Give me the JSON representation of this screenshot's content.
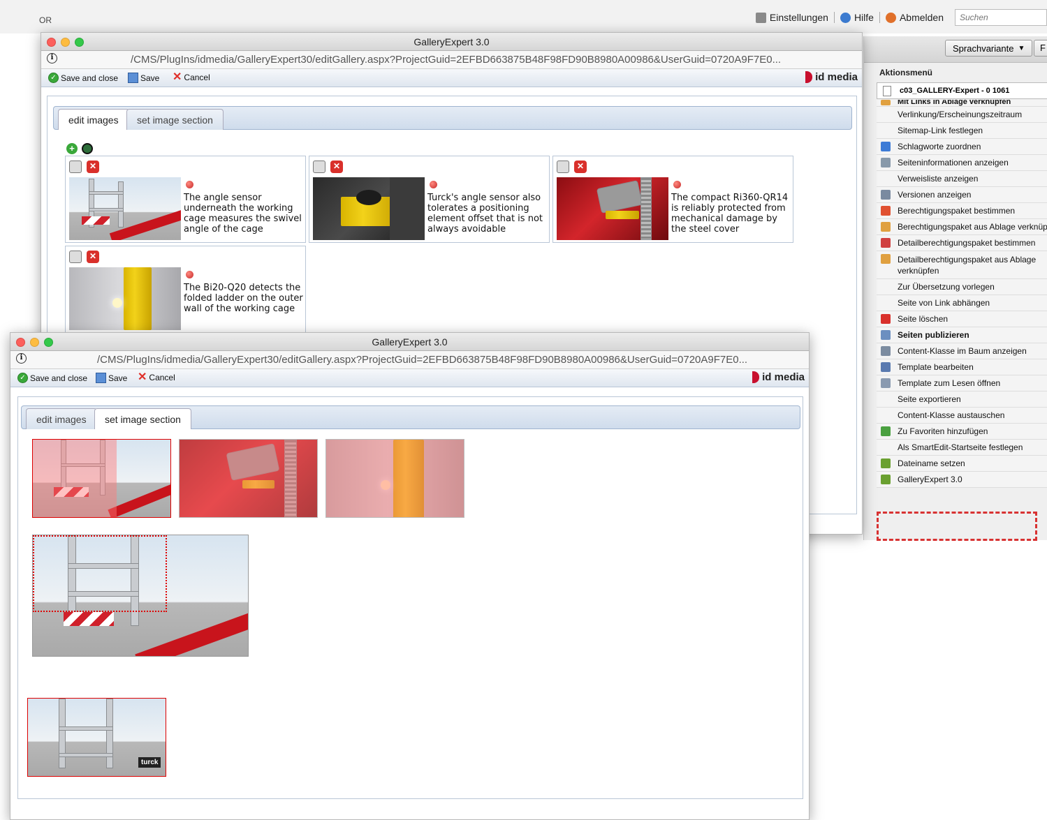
{
  "background": {
    "crumb": "OR",
    "top_actions": {
      "settings": "Einstellungen",
      "help": "Hilfe",
      "logout": "Abmelden",
      "search_placeholder": "Suchen"
    },
    "toolbar": {
      "language_button": "Sprachvariante",
      "f_button": "F"
    },
    "action_menu": {
      "title": "Aktionsmenü",
      "page_item": "c03_GALLERY-Expert - 0 1061",
      "items": [
        {
          "label": "Mit Links in Ablage verknüpfen",
          "icon": "folder-link-icon"
        },
        {
          "label": "Verlinkung/Erscheinungszeitraum",
          "icon": ""
        },
        {
          "label": "Sitemap-Link festlegen",
          "icon": ""
        },
        {
          "label": "Schlagworte zuordnen",
          "icon": "keyword-icon"
        },
        {
          "label": "Seiteninformationen anzeigen",
          "icon": "page-info-icon"
        },
        {
          "label": "Verweisliste anzeigen",
          "icon": ""
        },
        {
          "label": "Versionen anzeigen",
          "icon": "versions-icon"
        },
        {
          "label": "Berechtigungspaket bestimmen",
          "icon": "permission-icon"
        },
        {
          "label": "Berechtigungspaket aus Ablage verknüpfen",
          "icon": "permission-folder-icon"
        },
        {
          "label": "Detailberechtigungspaket bestimmen",
          "icon": "detail-permission-icon"
        },
        {
          "label": "Detailberechtigungspaket aus Ablage verknüpfen",
          "icon": "detail-permission-folder-icon"
        },
        {
          "label": "Zur Übersetzung vorlegen",
          "icon": ""
        },
        {
          "label": "Seite von Link abhängen",
          "icon": ""
        },
        {
          "label": "Seite löschen",
          "icon": "delete-icon"
        },
        {
          "label": "Seiten publizieren",
          "icon": "publish-icon"
        },
        {
          "label": "Content-Klasse im Baum anzeigen",
          "icon": "tree-icon"
        },
        {
          "label": "Template bearbeiten",
          "icon": "template-edit-icon"
        },
        {
          "label": "Template zum Lesen öffnen",
          "icon": "template-read-icon"
        },
        {
          "label": "Seite exportieren",
          "icon": ""
        },
        {
          "label": "Content-Klasse austauschen",
          "icon": ""
        },
        {
          "label": "Zu Favoriten hinzufügen",
          "icon": "favorite-icon"
        },
        {
          "label": "Als SmartEdit-Startseite festlegen",
          "icon": ""
        },
        {
          "label": "Dateiname setzen",
          "icon": "pencil-icon"
        },
        {
          "label": "GalleryExpert 3.0",
          "icon": "pencil-icon"
        }
      ]
    }
  },
  "window1": {
    "title": "GalleryExpert 3.0",
    "url": "/CMS/PlugIns/idmedia/GalleryExpert30/editGallery.aspx?ProjectGuid=2EFBD663875B48F98FD90B8980A00986&UserGuid=0720A9F7E0...",
    "actions": {
      "save_close": "Save and close",
      "save": "Save",
      "cancel": "Cancel"
    },
    "brand": "id media",
    "tabs": [
      "edit images",
      "set image section"
    ],
    "active_tab": 0,
    "images": [
      {
        "caption": "The angle sensor underneath the working cage measures the swivel angle of the cage"
      },
      {
        "caption": "Turck's angle sensor also tolerates a positioning element offset that is not always avoidable"
      },
      {
        "caption": "The compact Ri360-QR14 is reliably protected from mechanical damage by the steel cover"
      },
      {
        "caption": "The Bi20-Q20 detects the folded ladder on the outer wall of the working cage"
      }
    ]
  },
  "window2": {
    "title": "GalleryExpert 3.0",
    "url": "/CMS/PlugIns/idmedia/GalleryExpert30/editGallery.aspx?ProjectGuid=2EFBD663875B48F98FD90B8980A00986&UserGuid=0720A9F7E0...",
    "actions": {
      "save_close": "Save and close",
      "save": "Save",
      "cancel": "Cancel"
    },
    "brand": "id media",
    "tabs": [
      "edit images",
      "set image section"
    ],
    "active_tab": 1,
    "preview_watermark": "turck"
  },
  "colors": {
    "accent_red": "#d83232",
    "brand_red": "#c8102e",
    "selection_pink": "#ff7878"
  }
}
